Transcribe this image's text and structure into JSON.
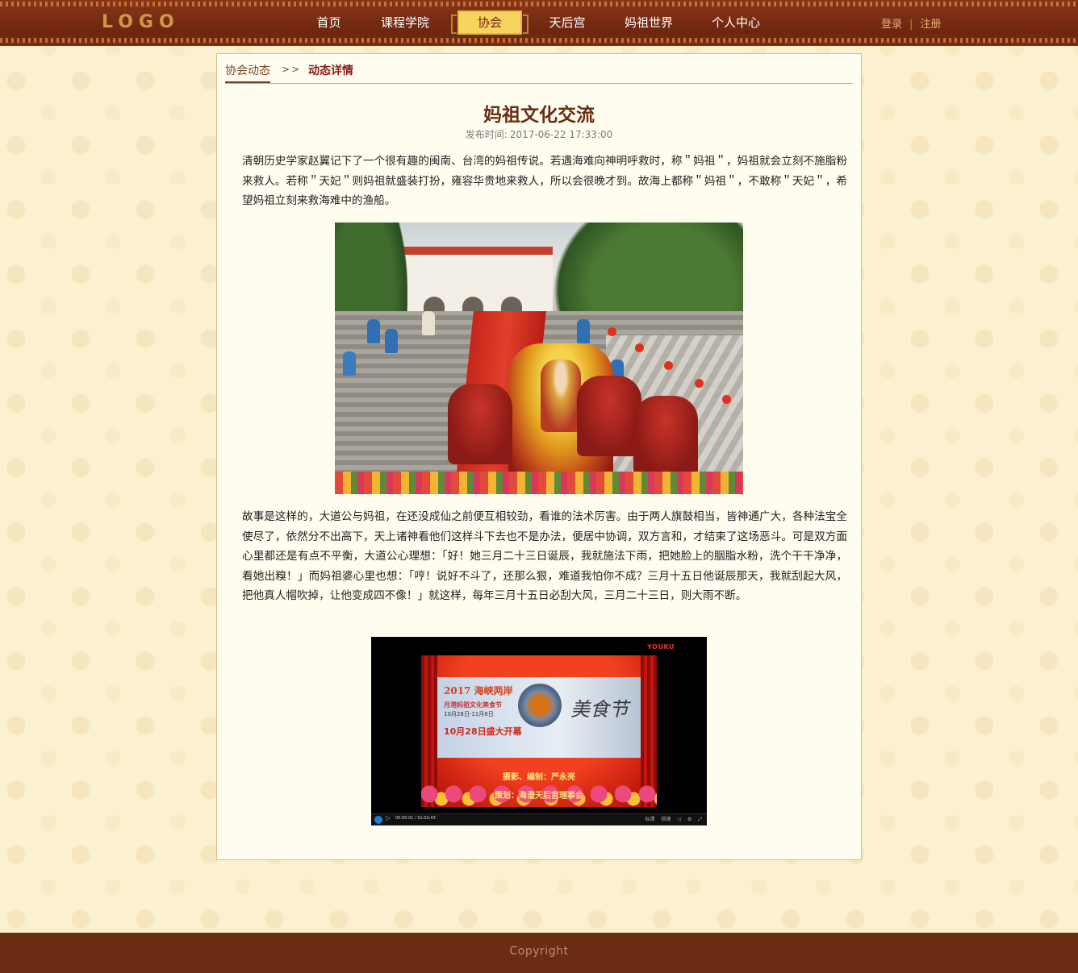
{
  "header": {
    "logo": "LOGO",
    "nav": [
      {
        "label": "首页"
      },
      {
        "label": "课程学院"
      },
      {
        "label": "协会",
        "active": true
      },
      {
        "label": "天后宫"
      },
      {
        "label": "妈祖世界"
      },
      {
        "label": "个人中心"
      }
    ],
    "login": "登录",
    "separator": "|",
    "register": "注册"
  },
  "breadcrumb": {
    "parent": "协会动态",
    "arrow": ">>",
    "current": "动态详情"
  },
  "article": {
    "title": "妈祖文化交流",
    "publish_label": "发布时间:",
    "publish_time": "2017-06-22 17:33:00",
    "paragraph1": "清朝历史学家赵翼记下了一个很有趣的闽南、台湾的妈祖传说。若遇海难向神明呼救时，称＂妈祖＂，妈祖就会立刻不施脂粉来救人。若称＂天妃＂则妈祖就盛装打扮，雍容华贵地来救人，所以会很晚才到。故海上都称＂妈祖＂，不敢称＂天妃＂，希望妈祖立刻来救海难中的渔船。",
    "paragraph2": "故事是这样的，大道公与妈祖，在还没成仙之前便互相较劲，看谁的法术厉害。由于两人旗鼓相当，皆神通广大，各种法宝全使尽了，依然分不出高下，天上诸神看他们这样斗下去也不是办法，便居中协调，双方言和，才结束了这场恶斗。可是双方面心里都还是有点不平衡，大道公心理想：「好！她三月二十三日诞辰，我就施法下雨，把她脸上的胭脂水粉，洗个干干净净，看她出糗！」而妈祖婆心里也想：「哼！说好不斗了，还那么狠，难道我怕你不成？三月十五日他诞辰那天，我就刮起大风，把他真人帽吹掉，让他变成四不像！」就这样，每年三月十五日必刮大风，三月二十三日，则大雨不断。"
  },
  "video": {
    "watermark": "YOUKU",
    "banner_title": "2017 海峡两岸",
    "banner_subtitle": "月港妈祖文化美食节",
    "banner_dates": "10月28日-11月8日",
    "banner_open": "10月28日盛大开幕",
    "festival": "美食节",
    "credit1": "摄影、编制：严永亮",
    "credit2": "策划：海澄天后宫理事会",
    "time": "00:00:01 / 01:02:43",
    "ctrl_quality": "标清",
    "ctrl_speed": "倍速",
    "ctrl_volume": "◁",
    "ctrl_settings": "⚙",
    "ctrl_fullscreen": "⤢"
  },
  "footer": {
    "copyright": "Copyright"
  },
  "colors": {
    "header_bg": "#7a2e13",
    "nav_active_bg": "#f6d55e",
    "title": "#6a2d10",
    "footer_bg": "#6a2c12",
    "page_bg": "#fbf0cf"
  }
}
